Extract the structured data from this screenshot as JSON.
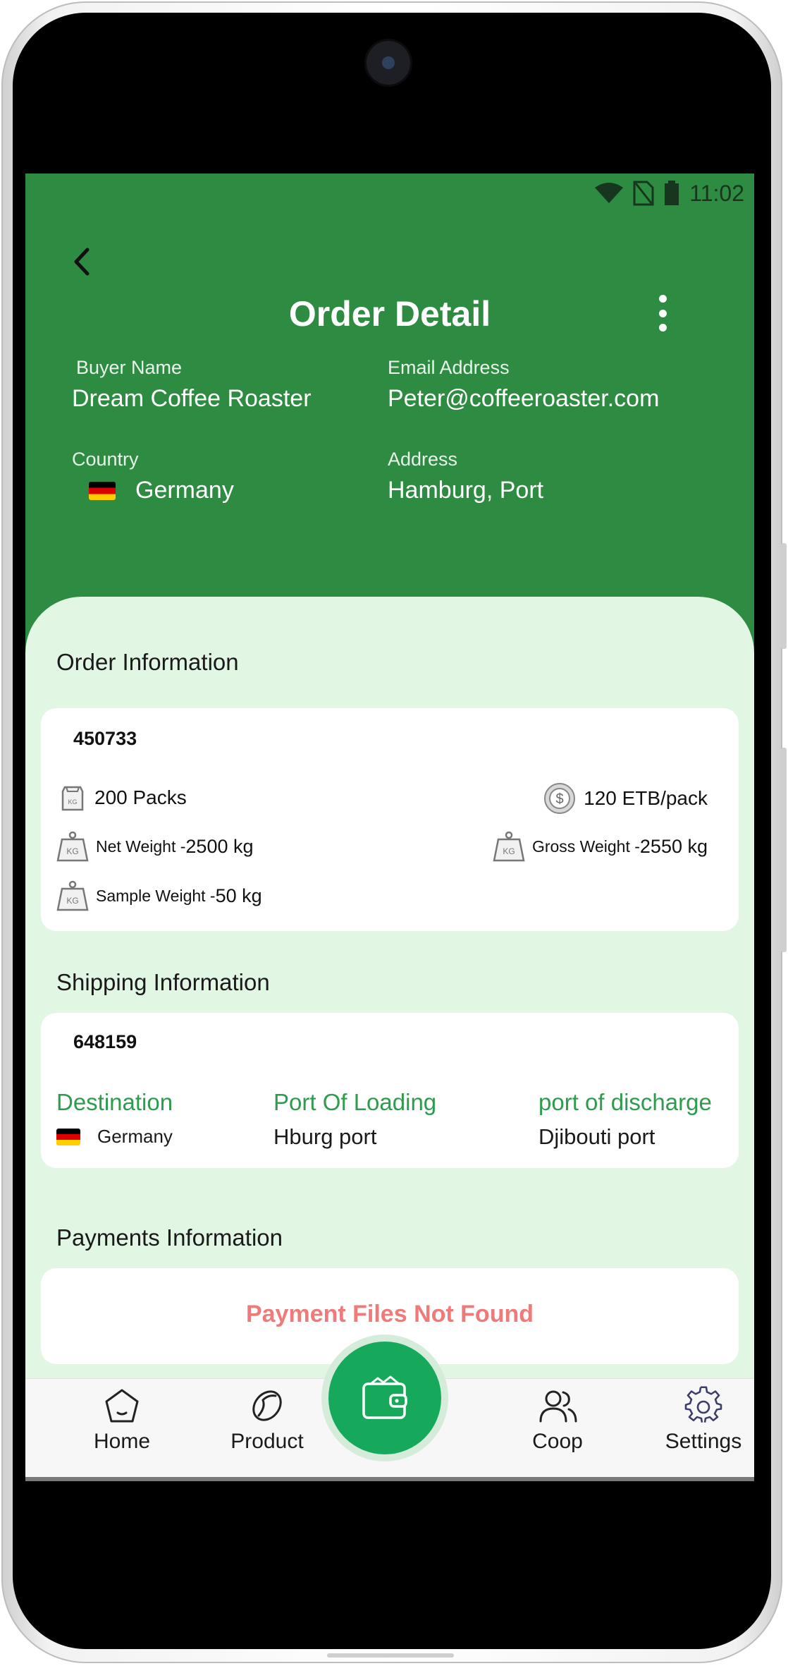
{
  "status_bar": {
    "time": "11:02",
    "icons": [
      "wifi-icon",
      "no-sim-icon",
      "battery-icon"
    ]
  },
  "header": {
    "title": "Order Detail"
  },
  "buyer": {
    "name_label": "Buyer Name",
    "name": "Dream Coffee Roaster",
    "email_label": "Email Address",
    "email": "Peter@coffeeroaster.com",
    "country_label": "Country",
    "country": "Germany",
    "address_label": "Address",
    "address": "Hamburg, Port"
  },
  "order_info": {
    "title": "Order Information",
    "order_id": "450733",
    "packs": "200 Packs",
    "price": "120 ETB/pack",
    "net_weight_label": "Net Weight -",
    "net_weight": "2500 kg",
    "gross_weight_label": "Gross Weight -",
    "gross_weight": "2550 kg",
    "sample_weight_label": "Sample Weight -",
    "sample_weight": "50 kg"
  },
  "shipping_info": {
    "title": "Shipping Information",
    "shipping_id": "648159",
    "destination_label": "Destination",
    "destination": "Germany",
    "loading_label": "Port Of Loading",
    "loading": "Hburg port",
    "discharge_label": "port of discharge",
    "discharge": "Djibouti port"
  },
  "payments_info": {
    "title": "Payments Information",
    "empty_message": "Payment Files Not Found"
  },
  "nav": {
    "home": "Home",
    "product": "Product",
    "coop": "Coop",
    "settings": "Settings"
  },
  "colors": {
    "header_green": "#2e8b42",
    "sheet_bg": "#e2f7e3",
    "accent_green": "#2e9b4d",
    "fab_green": "#16a95c",
    "error_red": "#f07a7a"
  }
}
